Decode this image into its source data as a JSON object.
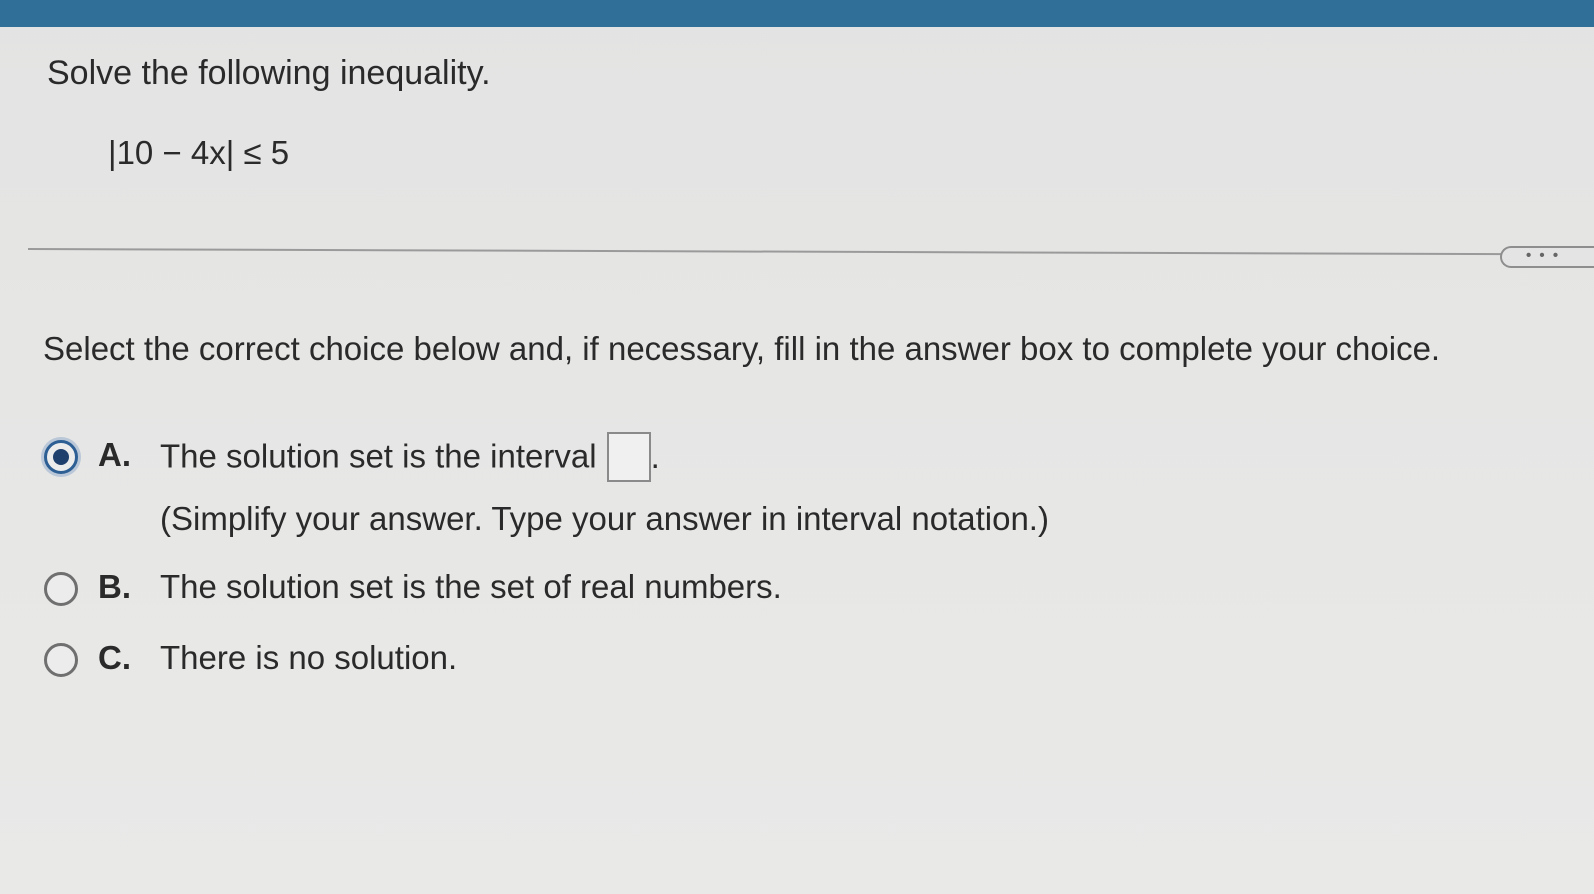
{
  "question": {
    "title": "Solve the following inequality.",
    "inequality": "|10 − 4x| ≤ 5"
  },
  "more_button": {
    "label": "• • •"
  },
  "instruction": "Select the correct choice below and, if necessary, fill in the answer box to complete your choice.",
  "options": [
    {
      "letter": "A.",
      "text": "The solution set is the interval",
      "suffix": ".",
      "hint": "(Simplify your answer. Type your answer in interval notation.)",
      "selected": true,
      "answer_value": ""
    },
    {
      "letter": "B.",
      "text": "The solution set is the set of real numbers.",
      "selected": false
    },
    {
      "letter": "C.",
      "text": "There is no solution.",
      "selected": false
    }
  ],
  "colors": {
    "top_bar": "#2f6f98",
    "selected_radio": "#1f3f6d",
    "background": "#e6e6e5"
  }
}
